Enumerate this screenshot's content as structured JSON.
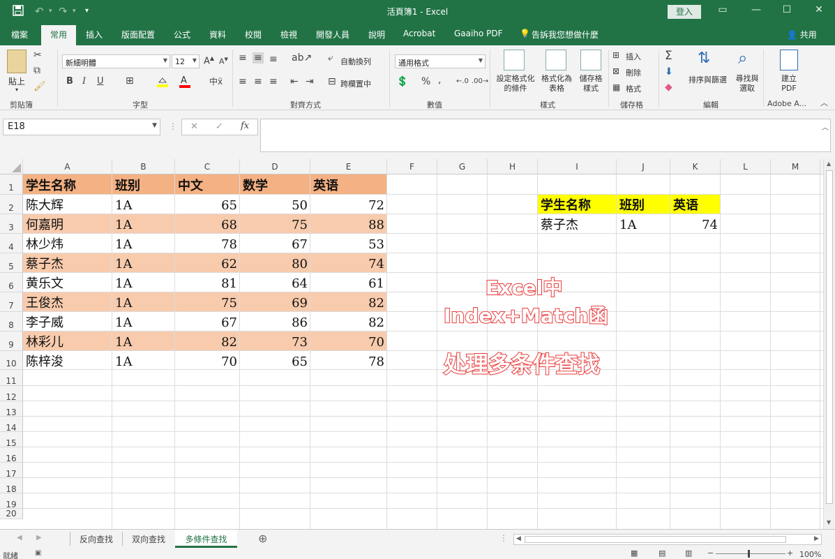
{
  "window": {
    "title": "活頁簿1 - Excel",
    "signin_label": "登入"
  },
  "ribbon_tabs": [
    "檔案",
    "常用",
    "插入",
    "版面配置",
    "公式",
    "資料",
    "校閱",
    "檢視",
    "開發人員",
    "說明",
    "Acrobat",
    "Gaaiho PDF",
    "告訴我您想做什麼"
  ],
  "share_label": "共用",
  "ribbon": {
    "clipboard": {
      "paste_label": "貼上",
      "group_label": "剪貼簿"
    },
    "font": {
      "font_name": "新細明體",
      "font_size": "12",
      "group_label": "字型"
    },
    "alignment": {
      "wrap_text": "自動換列",
      "merge_center": "跨欄置中",
      "group_label": "對齊方式"
    },
    "number": {
      "format": "通用格式",
      "group_label": "數值"
    },
    "styles": {
      "conditional": "設定格式化的條件",
      "format_table": "格式化為表格",
      "cell_styles": "儲存格樣式",
      "group_label": "樣式"
    },
    "cells": {
      "insert": "插入",
      "delete": "刪除",
      "format": "格式",
      "group_label": "儲存格"
    },
    "editing": {
      "sort_filter": "排序與篩選",
      "find_select": "尋找與選取",
      "group_label": "編輯"
    },
    "adobe": {
      "create_pdf": "建立PDF",
      "group_label": "Adobe A..."
    }
  },
  "formula_bar": {
    "name_box": "E18",
    "fx_label": "fx",
    "formula": ""
  },
  "columns": [
    "A",
    "B",
    "C",
    "D",
    "E",
    "F",
    "G",
    "H",
    "I",
    "J",
    "K",
    "L",
    "M"
  ],
  "rows": [
    "1",
    "2",
    "3",
    "4",
    "5",
    "6",
    "7",
    "8",
    "9",
    "10",
    "11",
    "12",
    "13",
    "14",
    "15",
    "16",
    "17",
    "18",
    "19",
    "20"
  ],
  "main_table": {
    "headers": [
      "学生名称",
      "班别",
      "中文",
      "数学",
      "英语"
    ],
    "rows": [
      [
        "陈大辉",
        "1A",
        "65",
        "50",
        "72"
      ],
      [
        "何嘉明",
        "1A",
        "68",
        "75",
        "88"
      ],
      [
        "林少炜",
        "1A",
        "78",
        "67",
        "53"
      ],
      [
        "蔡子杰",
        "1A",
        "62",
        "80",
        "74"
      ],
      [
        "黄乐文",
        "1A",
        "81",
        "64",
        "61"
      ],
      [
        "王俊杰",
        "1A",
        "75",
        "69",
        "82"
      ],
      [
        "李子威",
        "1A",
        "67",
        "86",
        "82"
      ],
      [
        "林彩儿",
        "1A",
        "82",
        "73",
        "70"
      ],
      [
        "陈梓浚",
        "1A",
        "70",
        "65",
        "78"
      ]
    ]
  },
  "lookup_table": {
    "headers": [
      "学生名称",
      "班别",
      "英语"
    ],
    "row": [
      "蔡子杰",
      "1A",
      "74"
    ]
  },
  "overlay_text": {
    "line1": "Excel中",
    "line2": "Index+Match函",
    "line3": "处理多条件查找"
  },
  "sheet_tabs": [
    "反向查找",
    "双向查找",
    "多條件查找"
  ],
  "active_sheet": "多條件查找",
  "status": {
    "ready": "就緒",
    "zoom": "100%"
  },
  "colors": {
    "excel_green": "#217346",
    "header_fill": "#f4b183",
    "band_fill": "#f8cbad",
    "lookup_header_fill": "#ffff00",
    "overlay_text": "#e83a3a"
  }
}
